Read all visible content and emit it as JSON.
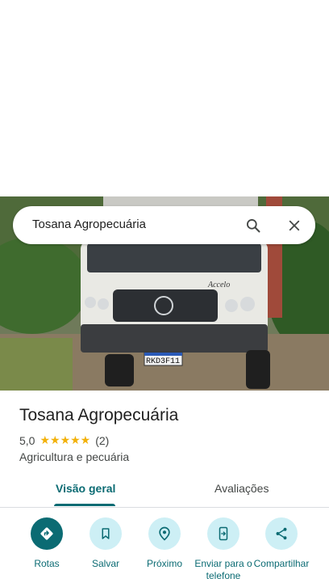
{
  "search": {
    "query": "Tosana Agropecuária",
    "icons": [
      "search-icon",
      "close-icon"
    ]
  },
  "photo": {
    "plate_text": "RKD3F11",
    "truck_badge": "Accelo"
  },
  "place": {
    "name": "Tosana Agropecuária",
    "rating": "5,0",
    "stars": "★★★★★",
    "review_count": "(2)",
    "category": "Agricultura e pecuária"
  },
  "tabs": {
    "overview": "Visão geral",
    "reviews": "Avaliações"
  },
  "actions": {
    "directions": "Rotas",
    "save": "Salvar",
    "nearby": "Próximo",
    "send_to_phone": "Enviar para o telefone",
    "share": "Compartilhar"
  },
  "colors": {
    "accent": "#0b6b73",
    "chip_bg": "#cdeff5",
    "star": "#f2b10a"
  }
}
